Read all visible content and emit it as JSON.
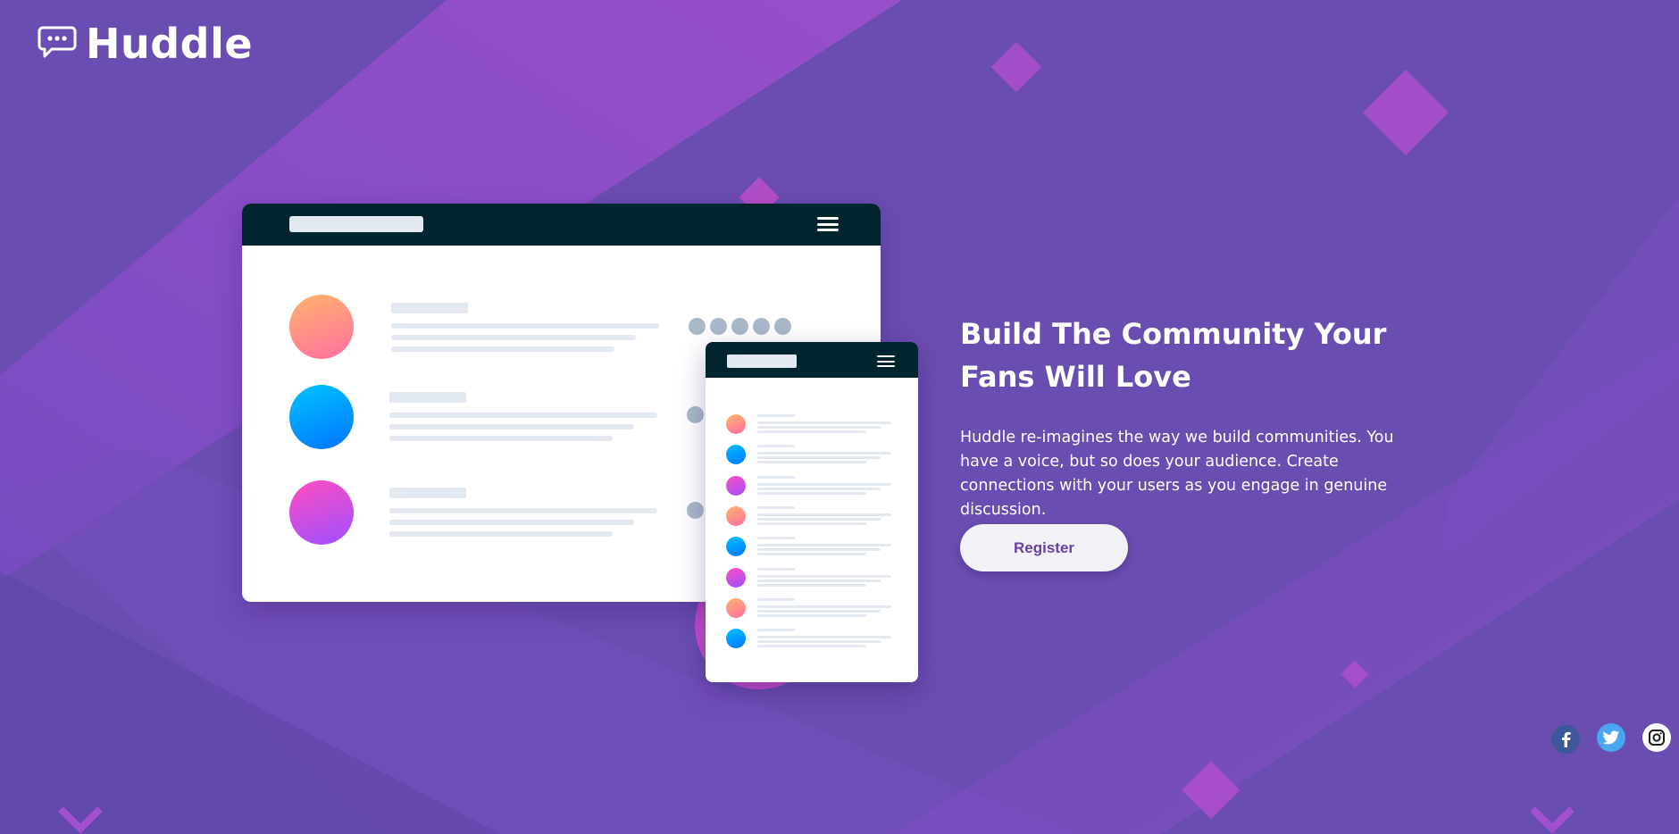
{
  "brand": {
    "name": "Huddle",
    "icon": "chat-bubble-icon"
  },
  "hero": {
    "headline": "Build The Community Your Fans Will Love",
    "description": "Huddle re-imagines the way we build communities. You have a voice, but so does your audience. Create connections with your users as you engage in genuine discussion.",
    "cta_label": "Register"
  },
  "mockup": {
    "desktop_rows": [
      {
        "avatar": "orange-gradient"
      },
      {
        "avatar": "blue-gradient"
      },
      {
        "avatar": "pink-gradient"
      }
    ],
    "mobile_rows": [
      {
        "avatar": "orange-gradient"
      },
      {
        "avatar": "blue-gradient"
      },
      {
        "avatar": "pink-gradient"
      },
      {
        "avatar": "orange-gradient"
      },
      {
        "avatar": "blue-gradient"
      },
      {
        "avatar": "pink-gradient"
      },
      {
        "avatar": "orange-gradient"
      },
      {
        "avatar": "blue-gradient"
      }
    ]
  },
  "social": [
    {
      "name": "facebook",
      "icon": "facebook-icon"
    },
    {
      "name": "twitter",
      "icon": "twitter-icon"
    },
    {
      "name": "instagram",
      "icon": "instagram-icon"
    }
  ],
  "colors": {
    "background": "#6a4db0",
    "accent_violet": "#a24fd0",
    "navbar": "#00252e",
    "button_bg": "#f2f1f5",
    "button_text": "#6941a6"
  }
}
